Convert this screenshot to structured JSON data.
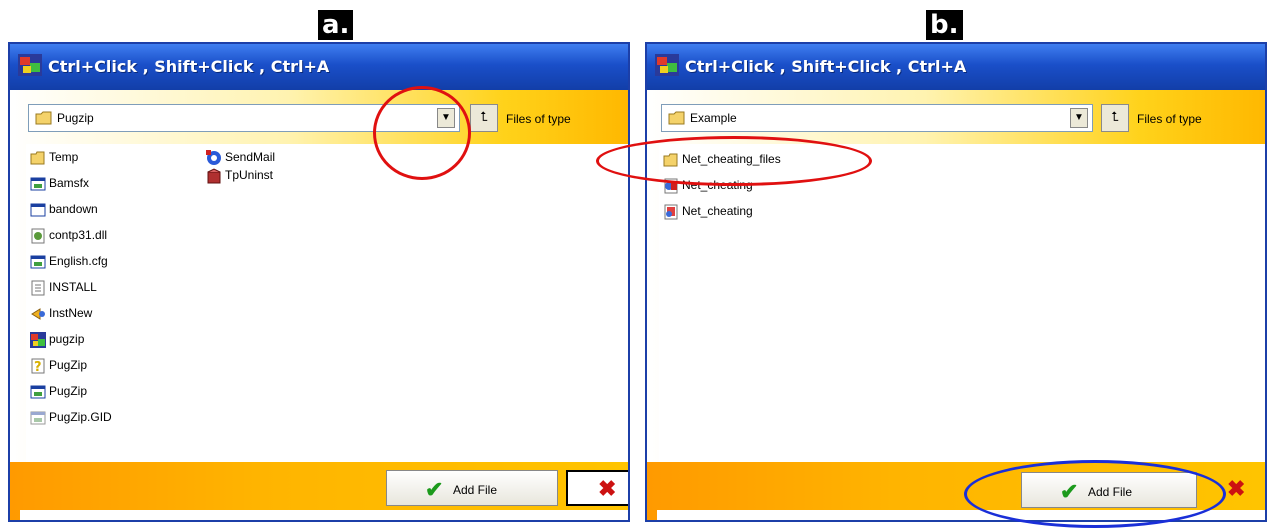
{
  "panels": [
    {
      "label": "a.",
      "title": "Ctrl+Click , Shift+Click , Ctrl+A",
      "folder": "Pugzip",
      "files_of_type": "Files of type",
      "add_file": "Add File",
      "column1": [
        "Temp",
        "Bamsfx",
        "bandown",
        "contp31.dll",
        "English.cfg",
        "INSTALL",
        "InstNew",
        "pugzip",
        "PugZip",
        "PugZip",
        "PugZip.GID"
      ],
      "column2": [
        "SendMail",
        "TpUninst"
      ]
    },
    {
      "label": "b.",
      "title": "Ctrl+Click , Shift+Click , Ctrl+A",
      "folder": "Example",
      "files_of_type": "Files of type",
      "add_file": "Add File",
      "column1": [
        "Net_cheating_files",
        "Net_cheating",
        "Net_cheating"
      ]
    }
  ],
  "highlight_colors": {
    "red": "#e01010",
    "blue": "#1a2fd8"
  }
}
